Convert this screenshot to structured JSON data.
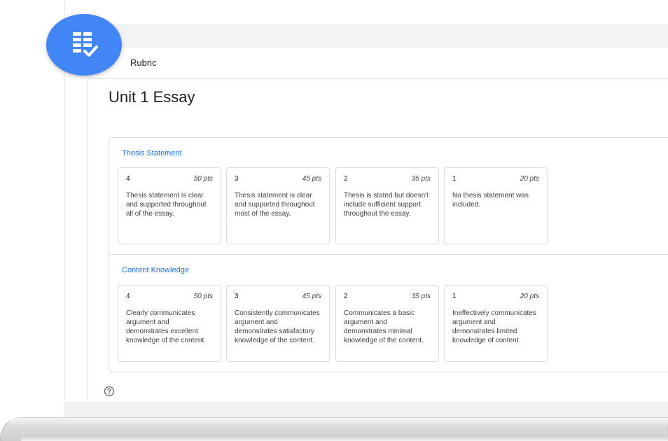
{
  "header": {
    "title": "Rubric"
  },
  "page": {
    "title": "Unit 1 Essay"
  },
  "icons": {
    "app": "rubric-checklist-icon",
    "help": "help-icon"
  },
  "colors": {
    "accent": "#1a73e8",
    "badge": "#4285f4"
  },
  "rubric": {
    "criteria": [
      {
        "title": "Thesis Statement",
        "levels": [
          {
            "score": "4",
            "points": "50 pts",
            "description": "Thesis statement is clear and supported throughout all of the essay."
          },
          {
            "score": "3",
            "points": "45 pts",
            "description": "Thesis statement is clear and supported throughout most of the essay."
          },
          {
            "score": "2",
            "points": "35 pts",
            "description": "Thesis is stated but doesn't include sufficient support throughout the essay."
          },
          {
            "score": "1",
            "points": "20 pts",
            "description": "No thesis statement was included."
          }
        ]
      },
      {
        "title": "Content Knowledge",
        "levels": [
          {
            "score": "4",
            "points": "50 pts",
            "description": "Clearly communicates argument and demonstrates excellent knowledge of the content."
          },
          {
            "score": "3",
            "points": "45 pts",
            "description": "Consistently communicates argument and demonstrates satisfactory knowledge of the content."
          },
          {
            "score": "2",
            "points": "35 pts",
            "description": "Communicates a basic argument and demonstrates minimal knowledge of the content."
          },
          {
            "score": "1",
            "points": "20 pts",
            "description": "Ineffectively communicates argument and demonstrates limited knowledge of content."
          }
        ]
      }
    ]
  }
}
